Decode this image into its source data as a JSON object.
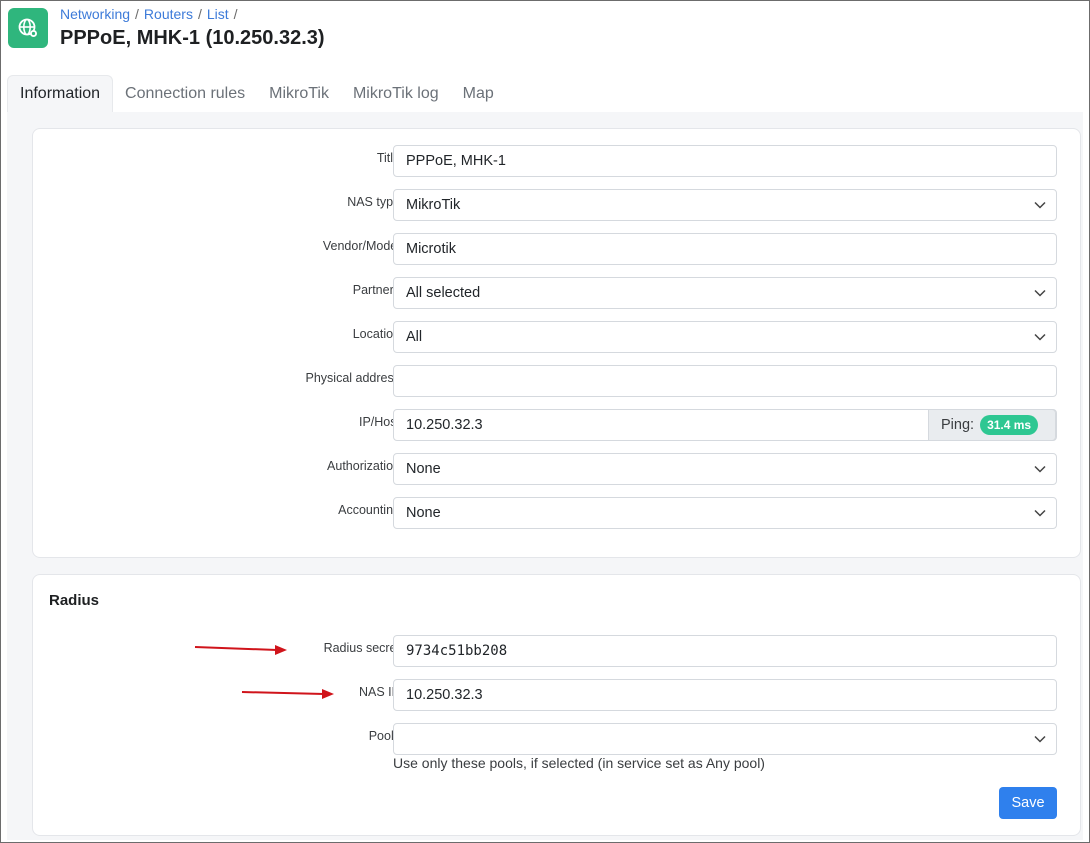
{
  "header": {
    "breadcrumbs": [
      "Networking",
      "Routers",
      "List"
    ],
    "title": "PPPoE, MHK-1 (10.250.32.3)"
  },
  "tabs": [
    {
      "label": "Information",
      "active": true
    },
    {
      "label": "Connection rules"
    },
    {
      "label": "MikroTik"
    },
    {
      "label": "MikroTik log"
    },
    {
      "label": "Map"
    }
  ],
  "info_form": {
    "title": {
      "label": "Title",
      "value": "PPPoE, MHK-1"
    },
    "nas_type": {
      "label": "NAS type",
      "value": "MikroTik"
    },
    "vendor_model": {
      "label": "Vendor/Model",
      "value": "Microtik"
    },
    "partners": {
      "label": "Partners",
      "value": "All selected"
    },
    "location": {
      "label": "Location",
      "value": "All"
    },
    "physical_address": {
      "label": "Physical address",
      "value": ""
    },
    "ip_host": {
      "label": "IP/Host",
      "value": "10.250.32.3",
      "ping_label": "Ping:",
      "ping_value": "31.4 ms"
    },
    "authorization": {
      "label": "Authorization",
      "value": "None"
    },
    "accounting": {
      "label": "Accounting",
      "value": "None"
    }
  },
  "radius": {
    "section_title": "Radius",
    "radius_secret": {
      "label": "Radius secret",
      "value": "9734c51bb208"
    },
    "nas_ip": {
      "label": "NAS IP",
      "value": "10.250.32.3"
    },
    "pools": {
      "label": "Pools",
      "value": "",
      "help": "Use only these pools, if selected (in service set as Any pool)"
    },
    "save_label": "Save"
  },
  "colors": {
    "accent": "#2f80ed",
    "app_icon": "#2fb67d",
    "ping_badge": "#2ec792",
    "annotation_arrow": "#d0141b"
  },
  "icons": {
    "app": "globe-network-icon",
    "select": "chevron-down-icon",
    "annotation": "red-arrow"
  }
}
